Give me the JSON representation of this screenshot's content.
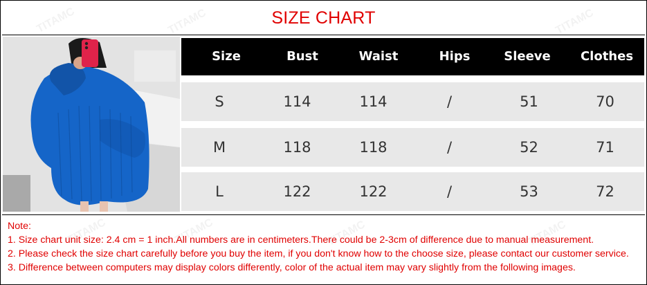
{
  "title": "SIZE CHART",
  "watermark": "TITAMC",
  "table": {
    "headers": [
      "Size",
      "Bust",
      "Waist",
      "Hips",
      "Sleeve",
      "Clothes"
    ],
    "rows": [
      [
        "S",
        "114",
        "114",
        "/",
        "51",
        "70"
      ],
      [
        "M",
        "118",
        "118",
        "/",
        "52",
        "71"
      ],
      [
        "L",
        "122",
        "122",
        "/",
        "53",
        "72"
      ]
    ]
  },
  "notes": [
    "Note:",
    "1. Size chart unit size: 2.4 cm = 1 inch.All numbers are in centimeters.There could be 2-3cm of difference due to manual measurement.",
    "2. Please check the size chart carefully before you buy the item, if you don't know how to the choose size, please contact our customer service.",
    "3. Difference between computers may display colors differently, color of the actual item may vary slightly from the following images."
  ],
  "colors": {
    "title": "#e00000",
    "note_text": "#e00000",
    "header_bg": "#000000",
    "row_bg": "#e8e8e8",
    "sweater": "#1565c8",
    "phone": "#e0234a"
  }
}
